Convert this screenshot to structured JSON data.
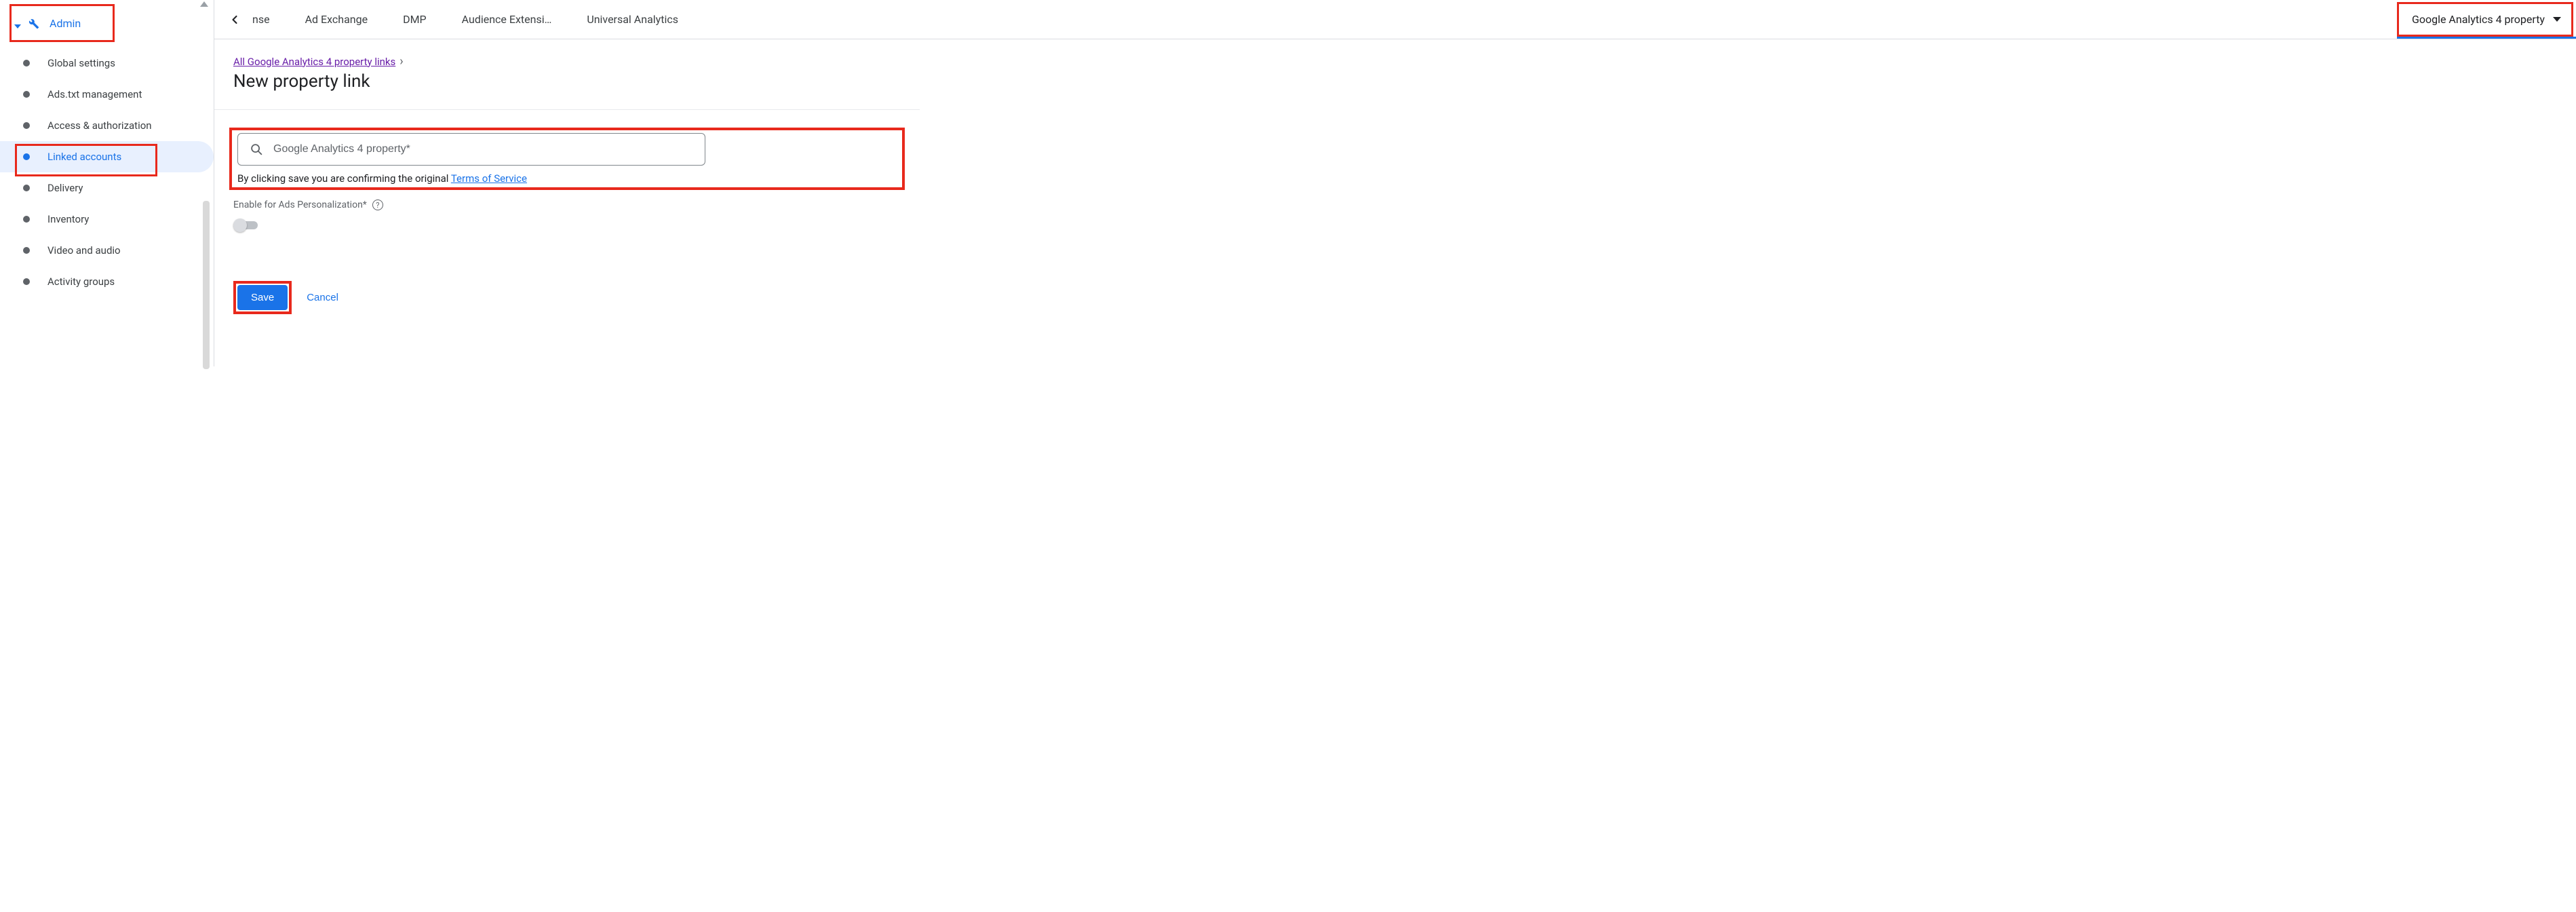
{
  "sidebar": {
    "admin_label": "Admin",
    "items": [
      {
        "label": "Global settings"
      },
      {
        "label": "Ads.txt management"
      },
      {
        "label": "Access & authorization"
      },
      {
        "label": "Linked accounts"
      },
      {
        "label": "Delivery"
      },
      {
        "label": "Inventory"
      },
      {
        "label": "Video and audio"
      },
      {
        "label": "Activity groups"
      }
    ],
    "active_index": 3
  },
  "tabs": {
    "truncated_first": "nse",
    "items": [
      "Ad Exchange",
      "DMP",
      "Audience Extensi…",
      "Universal Analytics"
    ],
    "dropdown_label": "Google Analytics 4 property"
  },
  "breadcrumb": {
    "link_label": "All Google Analytics 4 property links"
  },
  "page": {
    "title": "New property link"
  },
  "search": {
    "placeholder": "Google Analytics 4 property*",
    "value": ""
  },
  "tos": {
    "prefix": "By clicking save you are confirming the original ",
    "link_label": "Terms of Service"
  },
  "personalization": {
    "label": "Enable for Ads Personalization*",
    "enabled": false
  },
  "actions": {
    "save_label": "Save",
    "cancel_label": "Cancel"
  },
  "colors": {
    "accent": "#1a73e8",
    "highlight": "#e8291c"
  }
}
